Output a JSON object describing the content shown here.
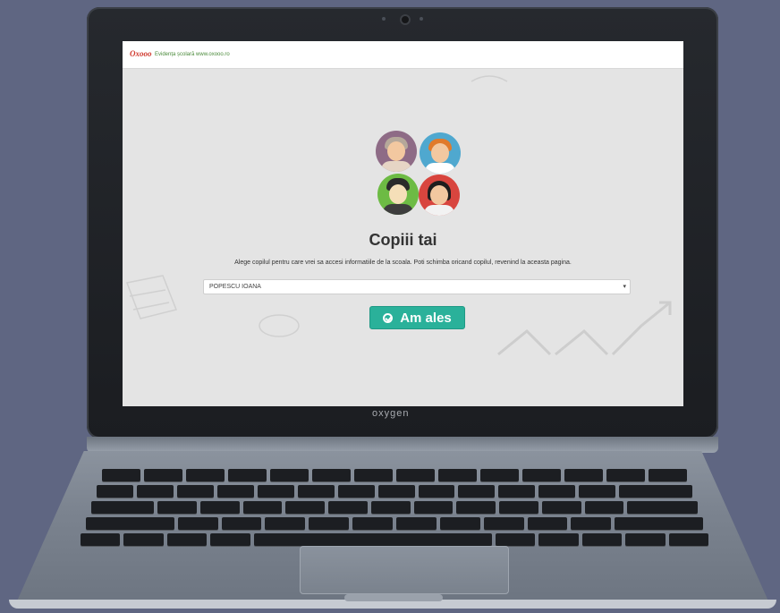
{
  "browser": {
    "logo": "Oxooo",
    "site_tag": "Evidența școlară www.oxooo.ro"
  },
  "page": {
    "title": "Copiii tai",
    "subtitle": "Alege copilul pentru care vrei sa accesi informatiile de la scoala. Poti schimba oricand copilul, revenind la aceasta pagina.",
    "select_value": "POPESCU IOANA",
    "select_arrow": "▾",
    "submit_label": "Am ales"
  },
  "laptop": {
    "brand": "oxygen"
  },
  "colors": {
    "accent": "#2ab19a",
    "background": "#5f6682",
    "screen_bg": "#e4e4e4"
  }
}
